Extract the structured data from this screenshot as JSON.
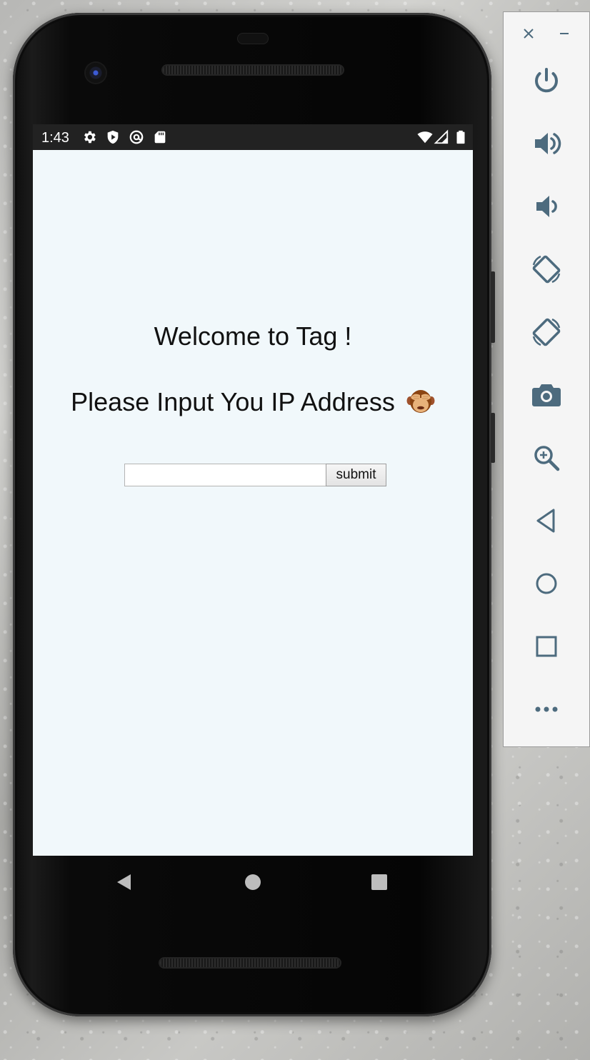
{
  "status_bar": {
    "time": "1:43",
    "left_icons": [
      "gear-icon",
      "shield-play-icon",
      "at-sign-icon",
      "sd-card-icon"
    ],
    "right_icons": [
      "wifi-icon",
      "cell-signal-icon",
      "battery-icon"
    ]
  },
  "app": {
    "welcome_text": "Welcome to Tag !",
    "prompt_text": "Please Input You IP Address",
    "prompt_emoji": "see-no-evil-monkey",
    "ip_input": {
      "value": "",
      "placeholder": ""
    },
    "submit_label": "submit",
    "background_color": "#f1f8fb"
  },
  "nav_bar": {
    "buttons": [
      "back-triangle-icon",
      "home-circle-icon",
      "recents-square-icon"
    ]
  },
  "emulator_panel": {
    "window_controls": [
      "close-icon",
      "minimize-icon"
    ],
    "tools": [
      "power-icon",
      "volume-up-icon",
      "volume-down-icon",
      "rotate-left-icon",
      "rotate-right-icon",
      "camera-icon",
      "zoom-icon",
      "back-icon",
      "home-icon",
      "overview-icon",
      "more-icon"
    ],
    "icon_color": "#4d6b7e"
  }
}
